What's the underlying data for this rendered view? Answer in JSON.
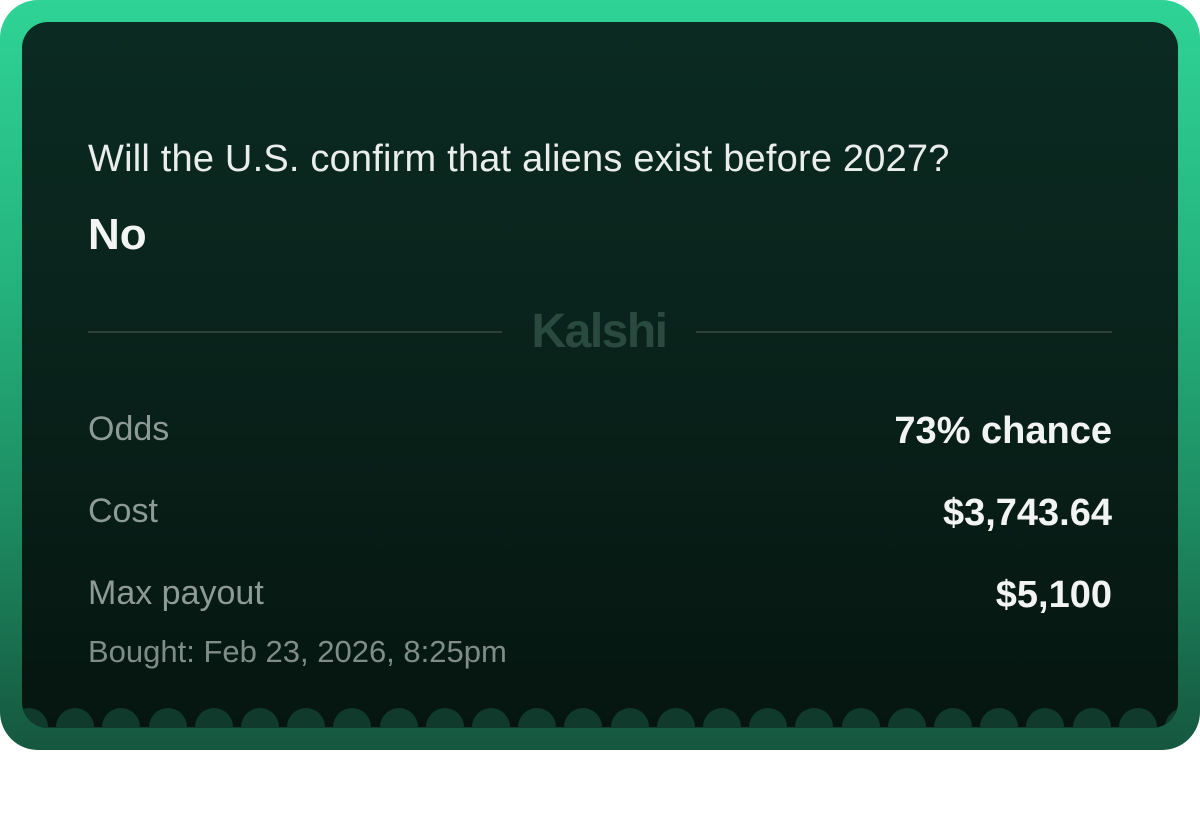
{
  "ticket": {
    "question": "Will the U.S. confirm that aliens exist before 2027?",
    "outcome": "No",
    "brand": "Kalshi",
    "rows": [
      {
        "label": "Odds",
        "value": "73% chance"
      },
      {
        "label": "Cost",
        "value": "$3,743.64"
      },
      {
        "label": "Max payout",
        "value": "$5,100"
      }
    ],
    "bought": "Bought: Feb 23, 2026, 8:25pm"
  },
  "colors": {
    "frame_accent": "#2fd396",
    "ticket_background": "#0b2a21",
    "brand_text": "#2b4a3f",
    "scallop_edge": "#103a2c"
  }
}
